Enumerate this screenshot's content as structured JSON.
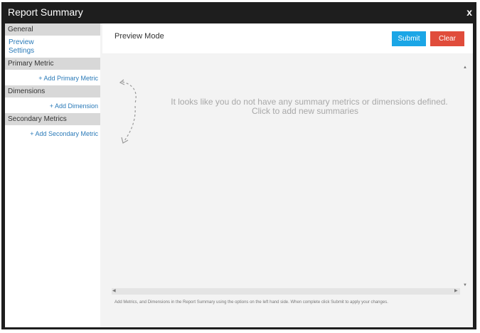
{
  "window": {
    "title": "Report Summary",
    "close_glyph": "x"
  },
  "sidebar": {
    "general": {
      "header": "General",
      "links": [
        "Preview",
        "Settings"
      ]
    },
    "primary_metric": {
      "header": "Primary Metric",
      "add_label": "+ Add Primary Metric"
    },
    "dimensions": {
      "header": "Dimensions",
      "add_label": "+ Add Dimension"
    },
    "secondary_metrics": {
      "header": "Secondary Metrics",
      "add_label": "+ Add Secondary Metric"
    }
  },
  "main": {
    "title": "Preview Mode",
    "submit_label": "Submit",
    "clear_label": "Clear",
    "empty_line1": "It looks like you do not have any summary metrics or dimensions defined.",
    "empty_line2": "Click  to add new summaries",
    "footer_note": "Add Metrics, and Dimensions in the Report Summary using the options on the left hand side. When complete click Submit to apply your changes.",
    "arrow_icon": "curved-dashed-arrow"
  },
  "colors": {
    "title_bar": "#1e1e1e",
    "link": "#2a7ab8",
    "submit": "#1ba6e6",
    "clear": "#e04c3b",
    "section_header": "#d8d8d8"
  }
}
